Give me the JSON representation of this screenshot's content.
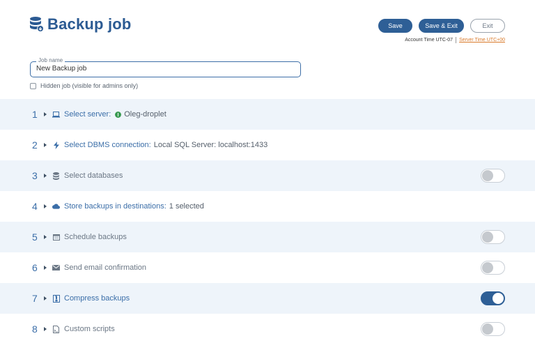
{
  "header": {
    "title": "Backup job",
    "title_icon": "database-backup-icon",
    "buttons": {
      "save": "Save",
      "save_exit": "Save & Exit",
      "exit": "Exit"
    },
    "account_time": "Account Time UTC-07",
    "server_time": "Server Time UTC+00"
  },
  "job": {
    "name_label": "Job name",
    "name_value": "New Backup job",
    "hidden_label": "Hidden job (visible for admins only)",
    "hidden_checked": false
  },
  "steps": [
    {
      "num": "1",
      "label": "Select server:",
      "value": "Oleg-droplet",
      "icon": "laptop-icon",
      "status": "online"
    },
    {
      "num": "2",
      "label": "Select DBMS connection:",
      "value": "Local SQL Server: localhost:1433",
      "icon": "lightning-icon"
    },
    {
      "num": "3",
      "label": "Select databases",
      "value": "",
      "icon": "database-icon",
      "toggle": false
    },
    {
      "num": "4",
      "label": "Store backups in destinations:",
      "value": "1 selected",
      "icon": "cloud-icon"
    },
    {
      "num": "5",
      "label": "Schedule backups",
      "value": "",
      "icon": "calendar-icon",
      "toggle": false
    },
    {
      "num": "6",
      "label": "Send email confirmation",
      "value": "",
      "icon": "envelope-icon",
      "toggle": false
    },
    {
      "num": "7",
      "label": "Compress backups",
      "value": "",
      "icon": "archive-icon",
      "toggle": true
    },
    {
      "num": "8",
      "label": "Custom scripts",
      "value": "",
      "icon": "script-file-icon",
      "toggle": false
    }
  ],
  "colors": {
    "accent": "#2e5f96",
    "row_alt": "#eef4fa",
    "status_ok": "#3a9a52",
    "link_orange": "#d97a2b"
  }
}
